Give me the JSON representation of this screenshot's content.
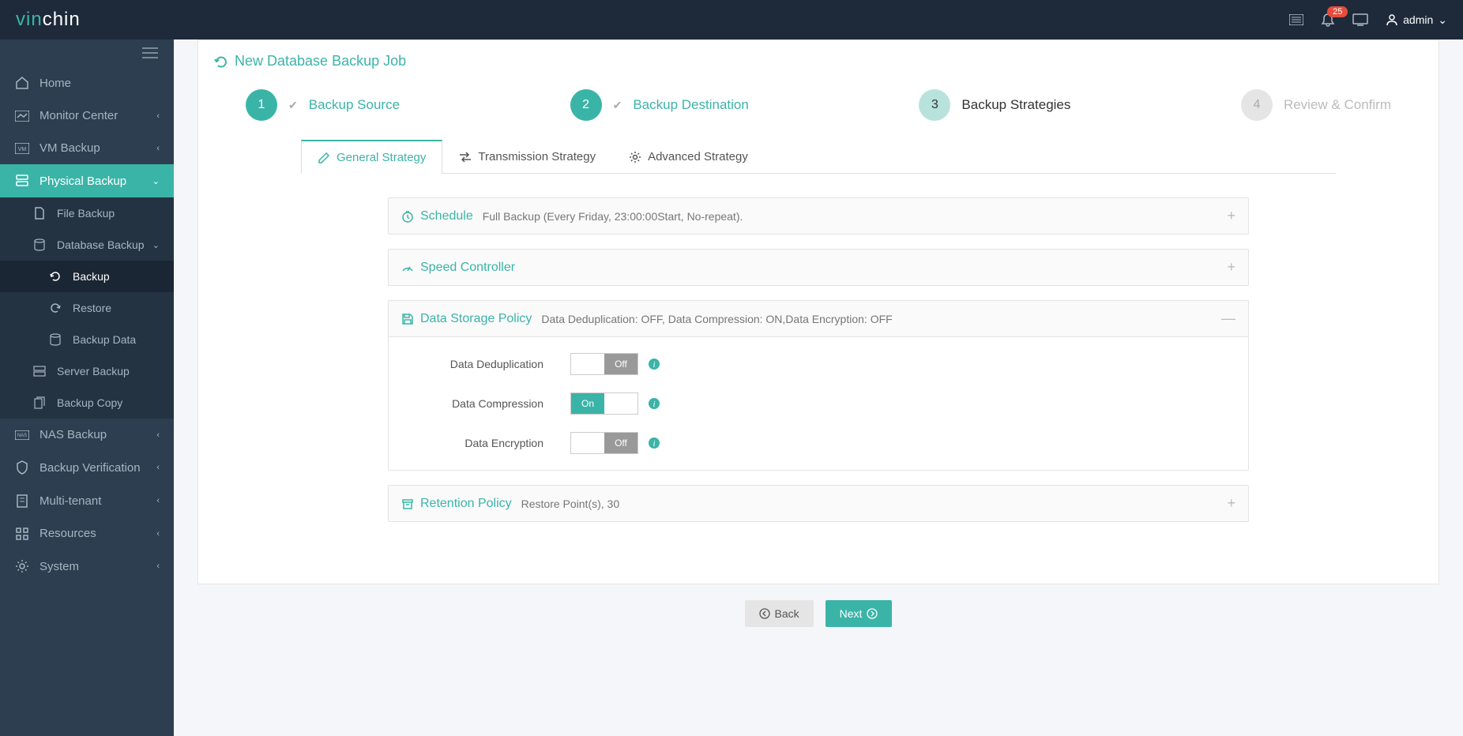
{
  "header": {
    "logo_part1": "vin",
    "logo_part2": "chin",
    "badge_count": "25",
    "username": "admin"
  },
  "sidebar": {
    "items": [
      {
        "label": "Home"
      },
      {
        "label": "Monitor Center"
      },
      {
        "label": "VM Backup"
      },
      {
        "label": "Physical Backup"
      },
      {
        "label": "NAS Backup"
      },
      {
        "label": "Backup Verification"
      },
      {
        "label": "Multi-tenant"
      },
      {
        "label": "Resources"
      },
      {
        "label": "System"
      }
    ],
    "physical_sub": [
      {
        "label": "File Backup"
      },
      {
        "label": "Database Backup"
      },
      {
        "label": "Server Backup"
      },
      {
        "label": "Backup Copy"
      }
    ],
    "db_sub": [
      {
        "label": "Backup"
      },
      {
        "label": "Restore"
      },
      {
        "label": "Backup Data"
      }
    ]
  },
  "page": {
    "title": "New Database Backup Job"
  },
  "wizard": {
    "step1": "Backup Source",
    "step2": "Backup Destination",
    "step3": "Backup Strategies",
    "step4": "Review & Confirm"
  },
  "tabs": {
    "general": "General Strategy",
    "transmission": "Transmission Strategy",
    "advanced": "Advanced Strategy"
  },
  "schedule": {
    "title": "Schedule",
    "summary": "Full Backup (Every Friday, 23:00:00Start, No-repeat)."
  },
  "speed": {
    "title": "Speed Controller"
  },
  "storage": {
    "title": "Data Storage Policy",
    "summary": "Data Deduplication: OFF, Data Compression: ON,Data Encryption: OFF",
    "dedup_label": "Data Deduplication",
    "compress_label": "Data Compression",
    "encrypt_label": "Data Encryption",
    "on_text": "On",
    "off_text": "Off"
  },
  "retention": {
    "title": "Retention Policy",
    "summary": "Restore Point(s), 30"
  },
  "buttons": {
    "back": "Back",
    "next": "Next"
  }
}
